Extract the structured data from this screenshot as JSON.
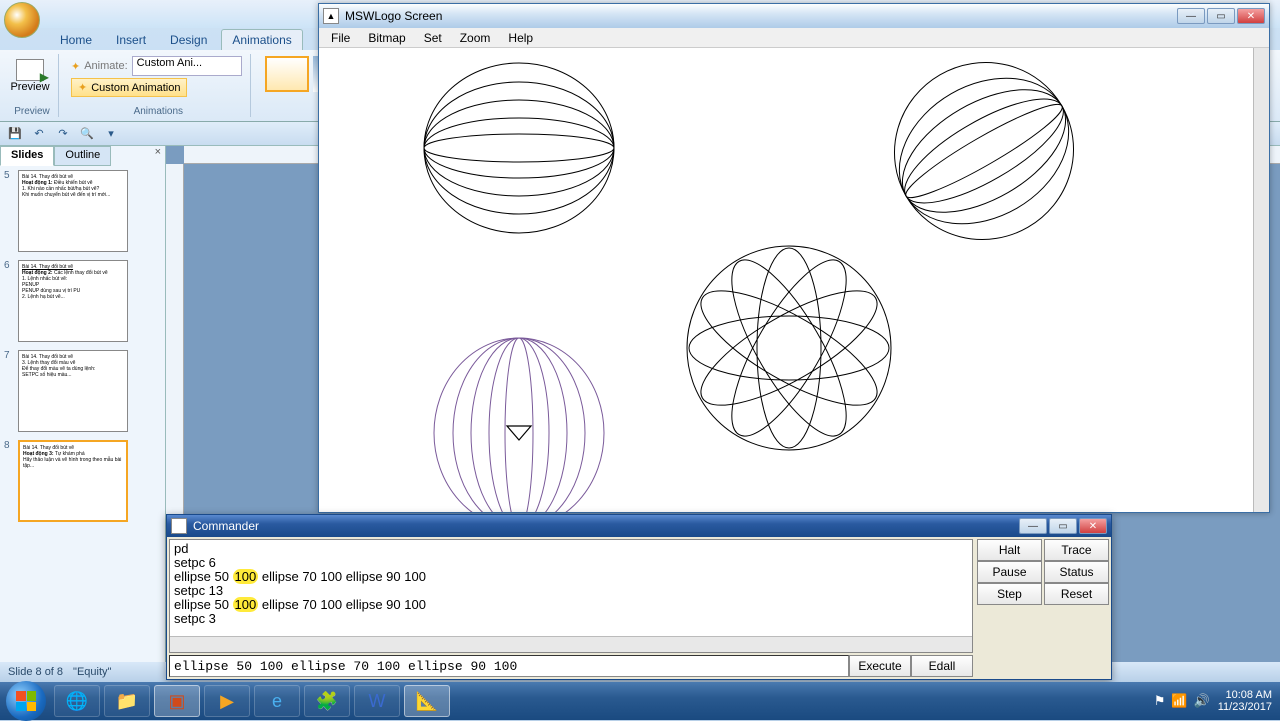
{
  "powerpoint": {
    "tabs": {
      "home": "Home",
      "insert": "Insert",
      "design": "Design",
      "animations": "Animations"
    },
    "ribbon": {
      "preview_label": "Preview",
      "preview_group": "Preview",
      "animate_label": "Animate:",
      "animate_value": "Custom Ani...",
      "custom_anim": "Custom Animation",
      "animations_group": "Animations"
    },
    "panel": {
      "slides_tab": "Slides",
      "outline_tab": "Outline"
    },
    "slides": [
      {
        "num": "5"
      },
      {
        "num": "6"
      },
      {
        "num": "7"
      },
      {
        "num": "8"
      }
    ],
    "status": {
      "slide": "Slide 8 of 8",
      "theme": "\"Equity\""
    }
  },
  "logo": {
    "title": "MSWLogo Screen",
    "menu": {
      "file": "File",
      "bitmap": "Bitmap",
      "set": "Set",
      "zoom": "Zoom",
      "help": "Help"
    }
  },
  "commander": {
    "title": "Commander",
    "history_lines": {
      "l1": "pd",
      "l2": "setpc 6",
      "l3a": "ellipse 50 ",
      "l3b": "100",
      "l3c": " ellipse 70 100 ellipse 90 100",
      "l4": "setpc 13",
      "l5a": "ellipse 50 ",
      "l5b": "100",
      "l5c": " ellipse 70 100 ellipse 90 100",
      "l6": "setpc 3"
    },
    "input": "ellipse 50 100 ellipse 70 100 ellipse 90 100",
    "buttons": {
      "halt": "Halt",
      "trace": "Trace",
      "pause": "Pause",
      "status": "Status",
      "step": "Step",
      "reset": "Reset",
      "execute": "Execute",
      "edall": "Edall"
    }
  },
  "taskbar": {
    "time": "10:08 AM",
    "date": "11/23/2017"
  }
}
